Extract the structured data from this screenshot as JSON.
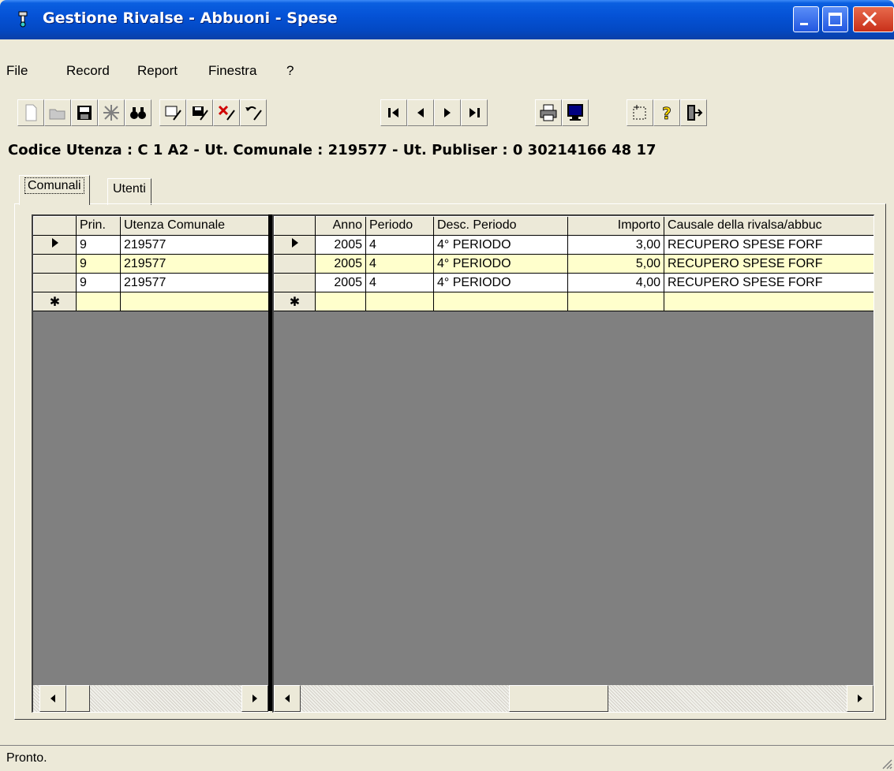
{
  "window": {
    "title": "Gestione Rivalse - Abbuoni - Spese",
    "minimize_icon": "minimize-icon",
    "maximize_icon": "maximize-icon",
    "close_icon": "close-icon"
  },
  "menu": [
    {
      "label": "File"
    },
    {
      "label": "Record"
    },
    {
      "label": "Report"
    },
    {
      "label": "Finestra"
    },
    {
      "label": "?"
    }
  ],
  "toolbar": {
    "icons": [
      "new-document-icon",
      "open-folder-icon",
      "save-icon",
      "filter-icon",
      "find-binoculars-icon",
      "edit-record-icon",
      "save-record-icon",
      "delete-record-icon",
      "undo-record-icon",
      "first-record-icon",
      "previous-record-icon",
      "next-record-icon",
      "last-record-icon",
      "print-icon",
      "preview-monitor-icon",
      "select-frame-icon",
      "help-question-icon",
      "exit-door-icon"
    ]
  },
  "header": {
    "codice_line": "Codice Utenza : C 1 A2 - Ut. Comunale : 219577 - Ut. Publiser : 0 30214166 48 17"
  },
  "tabs": [
    {
      "label": "Comunali",
      "active": true
    },
    {
      "label": "Utenti",
      "active": false
    }
  ],
  "left_grid": {
    "columns": [
      "Prin.",
      "Utenza Comunale"
    ],
    "rows": [
      {
        "prin": "9",
        "utenza": "219577"
      },
      {
        "prin": "9",
        "utenza": "219577"
      },
      {
        "prin": "9",
        "utenza": "219577"
      }
    ],
    "new_row_marker": "✱"
  },
  "right_grid": {
    "columns": [
      "Anno",
      "Periodo",
      "Desc. Periodo",
      "Importo",
      "Causale della rivalsa/abbuc"
    ],
    "rows": [
      {
        "anno": "2005",
        "periodo": "4",
        "desc": "4° PERIODO",
        "importo": "3,00",
        "causale": "RECUPERO SPESE FORF"
      },
      {
        "anno": "2005",
        "periodo": "4",
        "desc": "4° PERIODO",
        "importo": "5,00",
        "causale": "RECUPERO SPESE FORF"
      },
      {
        "anno": "2005",
        "periodo": "4",
        "desc": "4° PERIODO",
        "importo": "4,00",
        "causale": "RECUPERO SPESE FORF"
      }
    ],
    "new_row_marker": "✱"
  },
  "status": {
    "text": "Pronto."
  },
  "colors": {
    "titlebar": "#0552d6",
    "alt_row": "#ffffcc",
    "face": "#ece9d8"
  }
}
